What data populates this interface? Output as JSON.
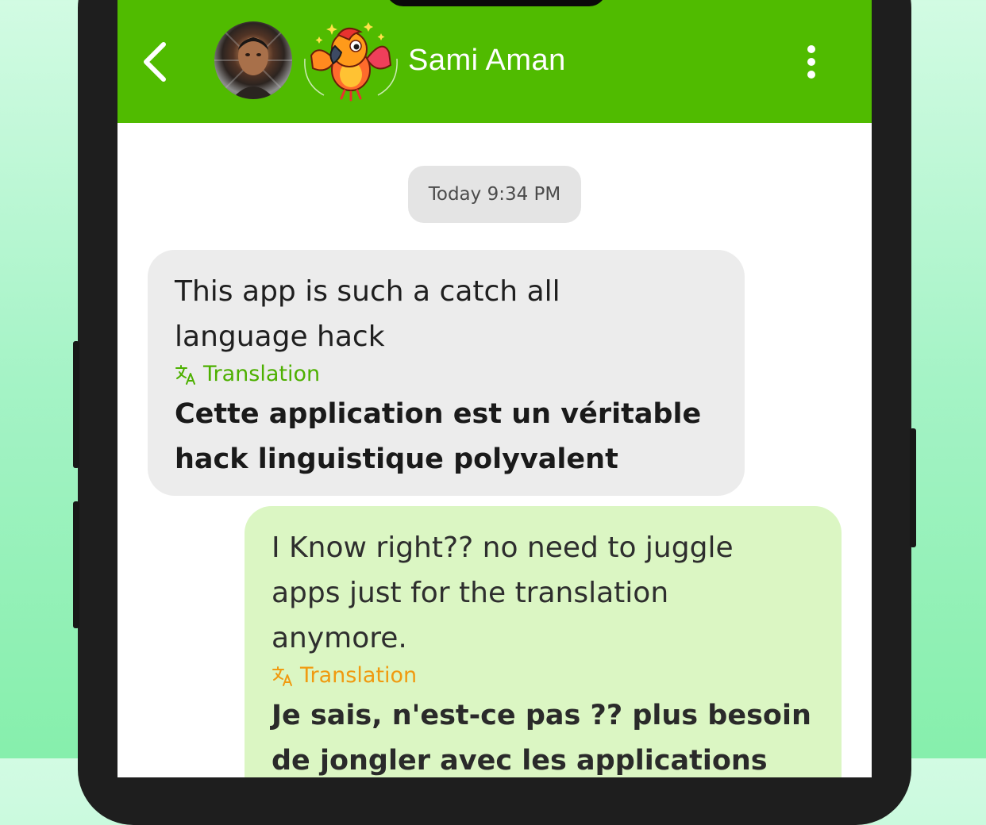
{
  "header": {
    "contact_name": "Sami Aman",
    "background_color": "#50bb00",
    "back_icon": "chevron-left-icon",
    "more_icon": "more-vertical-icon"
  },
  "chat": {
    "timestamp": "Today 9:34 PM",
    "messages": [
      {
        "direction": "incoming",
        "text_line1": "This app is such a catch all",
        "text_line2": "language hack",
        "translation_label": "Translation",
        "translation_line1": "Cette application est un véritable",
        "translation_line2": "hack linguistique polyvalent",
        "accent_color": "#4db000"
      },
      {
        "direction": "outgoing",
        "text_line1": "I Know right?? no need to juggle",
        "text_line2": "apps just for the translation",
        "text_line3": "anymore.",
        "translation_label": "Translation",
        "translation_line1": "Je sais, n'est-ce pas ?? plus besoin",
        "translation_line2": "de jongler avec les applications",
        "accent_color": "#f09a10"
      }
    ]
  }
}
